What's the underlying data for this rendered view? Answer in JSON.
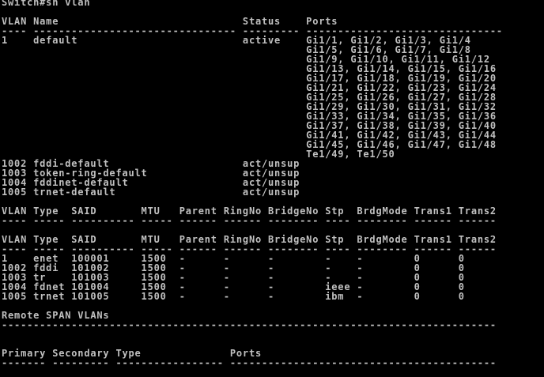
{
  "terminal": {
    "background": "#000000",
    "foreground": "#c0c0c0",
    "lines": [
      "Switch#sh vlan",
      "",
      "VLAN Name                             Status    Ports",
      "---- -------------------------------- --------- -------------------------------",
      "1    default                          active    Gi1/1, Gi1/2, Gi1/3, Gi1/4",
      "                                                Gi1/5, Gi1/6, Gi1/7, Gi1/8",
      "                                                Gi1/9, Gi1/10, Gi1/11, Gi1/12",
      "                                                Gi1/13, Gi1/14, Gi1/15, Gi1/16",
      "                                                Gi1/17, Gi1/18, Gi1/19, Gi1/20",
      "                                                Gi1/21, Gi1/22, Gi1/23, Gi1/24",
      "                                                Gi1/25, Gi1/26, Gi1/27, Gi1/28",
      "                                                Gi1/29, Gi1/30, Gi1/31, Gi1/32",
      "                                                Gi1/33, Gi1/34, Gi1/35, Gi1/36",
      "                                                Gi1/37, Gi1/38, Gi1/39, Gi1/40",
      "                                                Gi1/41, Gi1/42, Gi1/43, Gi1/44",
      "                                                Gi1/45, Gi1/46, Gi1/47, Gi1/48",
      "                                                Te1/49, Te1/50",
      "1002 fddi-default                     act/unsup",
      "1003 token-ring-default               act/unsup",
      "1004 fddinet-default                  act/unsup",
      "1005 trnet-default                    act/unsup",
      "",
      "VLAN Type  SAID       MTU   Parent RingNo BridgeNo Stp  BrdgMode Trans1 Trans2",
      "---- ----- ---------- ----- ------ ------ -------- ---- -------- ------ ------",
      "",
      "VLAN Type  SAID       MTU   Parent RingNo BridgeNo Stp  BrdgMode Trans1 Trans2",
      "---- ----- ---------- ----- ------ ------ -------- ---- -------- ------ ------",
      "1    enet  100001     1500  -      -      -        -    -        0      0",
      "1002 fddi  101002     1500  -      -      -        -    -        0      0",
      "1003 tr    101003     1500  -      -      -        -    -        0      0",
      "1004 fdnet 101004     1500  -      -      -        ieee -        0      0",
      "1005 trnet 101005     1500  -      -      -        ibm  -        0      0",
      "",
      "Remote SPAN VLANs",
      "------------------------------------------------------------------------------",
      "",
      "",
      "Primary Secondary Type              Ports",
      "------- --------- ----------------- ------------------------------------------"
    ]
  }
}
